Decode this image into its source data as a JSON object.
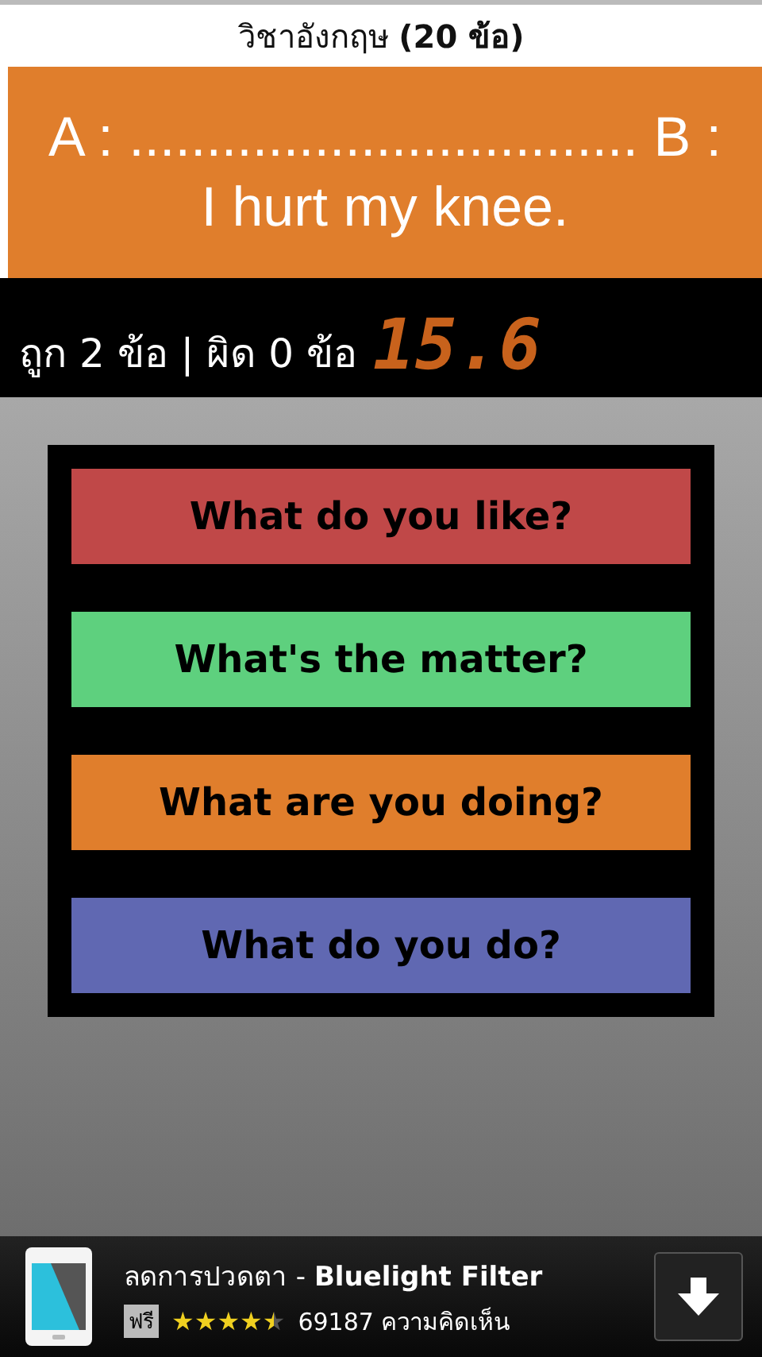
{
  "title": "วิชาอังกฤษ **(20 ข้อ)**",
  "question": {
    "line_1": "A : ................................. B :",
    "line_2": "I hurt my knee."
  },
  "score": {
    "text": "ถูก 2 ข้อ | ผิด 0 ข้อ",
    "timer": "15.6"
  },
  "answers": [
    {
      "label": "What do you like?",
      "color": "#c04848"
    },
    {
      "label": "What's the matter?",
      "color": "#5ed07e"
    },
    {
      "label": "What are you doing?",
      "color": "#e07e2c"
    },
    {
      "label": "What do you do?",
      "color": "#6068b2"
    }
  ],
  "ad": {
    "title": "ลดการปวดตา - **Bluelight Filter**",
    "badge": "ฟรี",
    "stars": 4.5,
    "reviews": "69187 ความคิดเห็น"
  }
}
